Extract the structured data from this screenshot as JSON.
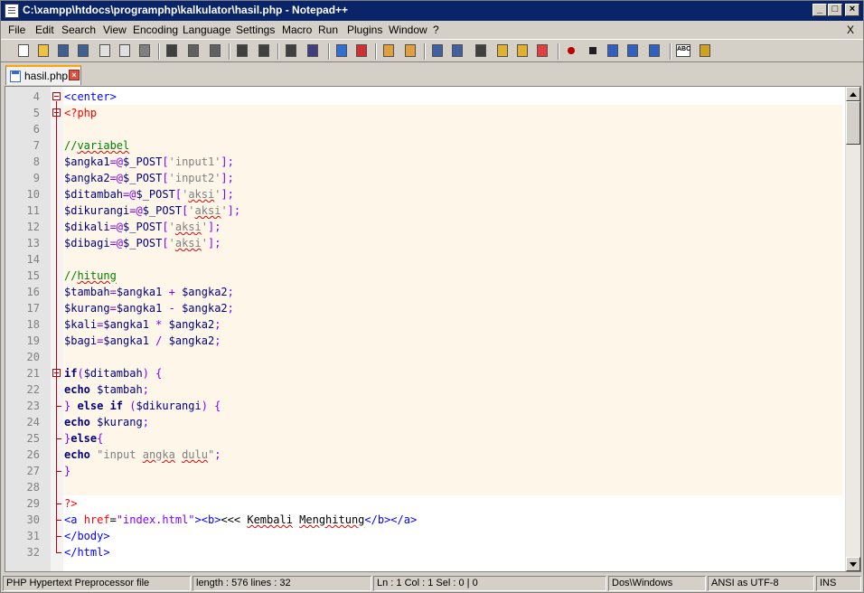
{
  "window": {
    "title": "C:\\xampp\\htdocs\\programphp\\kalkulator\\hasil.php - Notepad++",
    "min_glyph": "_",
    "max_glyph": "□",
    "close_glyph": "×"
  },
  "menubar": {
    "items": [
      "File",
      "Edit",
      "Search",
      "View",
      "Encoding",
      "Language",
      "Settings",
      "Macro",
      "Run",
      "Plugins",
      "Window",
      "?"
    ],
    "close_x": "X"
  },
  "toolbar": {
    "icons": [
      "new-file-icon",
      "open-file-icon",
      "save-icon",
      "save-all-icon",
      "close-icon",
      "close-all-icon",
      "print-icon",
      "cut-icon",
      "copy-icon",
      "paste-icon",
      "undo-icon",
      "redo-icon",
      "find-icon",
      "replace-icon",
      "zoom-in-icon",
      "zoom-out-icon",
      "sync-vertical-icon",
      "sync-horizontal-icon",
      "word-wrap-icon",
      "show-all-chars-icon",
      "indent-guide-icon",
      "udl-icon",
      "doc-map-icon",
      "function-list-icon",
      "record-macro-icon",
      "stop-macro-icon",
      "play-macro-icon",
      "play-multiple-macro-icon",
      "save-macro-icon",
      "spellcheck-icon",
      "spellcheck-settings-icon"
    ]
  },
  "tabs": [
    {
      "label": "hasil.php",
      "active": true
    }
  ],
  "editor": {
    "lines": [
      {
        "n": "4",
        "tokens": [
          {
            "t": "<center>",
            "c": "t-html"
          }
        ]
      },
      {
        "n": "5",
        "tokens": [
          {
            "t": "<?php",
            "c": "t-php"
          }
        ]
      },
      {
        "n": "6",
        "tokens": []
      },
      {
        "n": "7",
        "tokens": [
          {
            "t": "//",
            "c": "t-cmt"
          },
          {
            "t": "variabel",
            "c": "t-cmt spell"
          }
        ]
      },
      {
        "n": "8",
        "tokens": [
          {
            "t": "$angka1",
            "c": "t-var"
          },
          {
            "t": "=@",
            "c": "t-op"
          },
          {
            "t": "$_POST",
            "c": "t-var"
          },
          {
            "t": "[",
            "c": "t-op"
          },
          {
            "t": "'input1'",
            "c": "t-str"
          },
          {
            "t": "];",
            "c": "t-op"
          }
        ]
      },
      {
        "n": "9",
        "tokens": [
          {
            "t": "$angka2",
            "c": "t-var"
          },
          {
            "t": "=@",
            "c": "t-op"
          },
          {
            "t": "$_POST",
            "c": "t-var"
          },
          {
            "t": "[",
            "c": "t-op"
          },
          {
            "t": "'input2'",
            "c": "t-str"
          },
          {
            "t": "];",
            "c": "t-op"
          }
        ]
      },
      {
        "n": "10",
        "tokens": [
          {
            "t": "$ditambah",
            "c": "t-var"
          },
          {
            "t": "=@",
            "c": "t-op"
          },
          {
            "t": "$_POST",
            "c": "t-var"
          },
          {
            "t": "[",
            "c": "t-op"
          },
          {
            "t": "'",
            "c": "t-str"
          },
          {
            "t": "aksi",
            "c": "t-str spell"
          },
          {
            "t": "'",
            "c": "t-str"
          },
          {
            "t": "];",
            "c": "t-op"
          }
        ]
      },
      {
        "n": "11",
        "tokens": [
          {
            "t": "$dikurangi",
            "c": "t-var"
          },
          {
            "t": "=@",
            "c": "t-op"
          },
          {
            "t": "$_POST",
            "c": "t-var"
          },
          {
            "t": "[",
            "c": "t-op"
          },
          {
            "t": "'",
            "c": "t-str"
          },
          {
            "t": "aksi",
            "c": "t-str spell"
          },
          {
            "t": "'",
            "c": "t-str"
          },
          {
            "t": "];",
            "c": "t-op"
          }
        ]
      },
      {
        "n": "12",
        "tokens": [
          {
            "t": "$dikali",
            "c": "t-var"
          },
          {
            "t": "=@",
            "c": "t-op"
          },
          {
            "t": "$_POST",
            "c": "t-var"
          },
          {
            "t": "[",
            "c": "t-op"
          },
          {
            "t": "'",
            "c": "t-str"
          },
          {
            "t": "aksi",
            "c": "t-str spell"
          },
          {
            "t": "'",
            "c": "t-str"
          },
          {
            "t": "];",
            "c": "t-op"
          }
        ]
      },
      {
        "n": "13",
        "tokens": [
          {
            "t": "$dibagi",
            "c": "t-var"
          },
          {
            "t": "=@",
            "c": "t-op"
          },
          {
            "t": "$_POST",
            "c": "t-var"
          },
          {
            "t": "[",
            "c": "t-op"
          },
          {
            "t": "'",
            "c": "t-str"
          },
          {
            "t": "aksi",
            "c": "t-str spell"
          },
          {
            "t": "'",
            "c": "t-str"
          },
          {
            "t": "];",
            "c": "t-op"
          }
        ]
      },
      {
        "n": "14",
        "tokens": []
      },
      {
        "n": "15",
        "tokens": [
          {
            "t": "//",
            "c": "t-cmt"
          },
          {
            "t": "hitung",
            "c": "t-cmt spell"
          }
        ]
      },
      {
        "n": "16",
        "tokens": [
          {
            "t": "$tambah",
            "c": "t-var"
          },
          {
            "t": "=",
            "c": "t-op"
          },
          {
            "t": "$angka1",
            "c": "t-var"
          },
          {
            "t": " + ",
            "c": "t-op"
          },
          {
            "t": "$angka2",
            "c": "t-var"
          },
          {
            "t": ";",
            "c": "t-op"
          }
        ]
      },
      {
        "n": "17",
        "tokens": [
          {
            "t": "$kurang",
            "c": "t-var"
          },
          {
            "t": "=",
            "c": "t-op"
          },
          {
            "t": "$angka1",
            "c": "t-var"
          },
          {
            "t": " - ",
            "c": "t-op"
          },
          {
            "t": "$angka2",
            "c": "t-var"
          },
          {
            "t": ";",
            "c": "t-op"
          }
        ]
      },
      {
        "n": "18",
        "tokens": [
          {
            "t": "$kali",
            "c": "t-var"
          },
          {
            "t": "=",
            "c": "t-op"
          },
          {
            "t": "$angka1",
            "c": "t-var"
          },
          {
            "t": " * ",
            "c": "t-op"
          },
          {
            "t": "$angka2",
            "c": "t-var"
          },
          {
            "t": ";",
            "c": "t-op"
          }
        ]
      },
      {
        "n": "19",
        "tokens": [
          {
            "t": "$bagi",
            "c": "t-var"
          },
          {
            "t": "=",
            "c": "t-op"
          },
          {
            "t": "$angka1",
            "c": "t-var"
          },
          {
            "t": " / ",
            "c": "t-op"
          },
          {
            "t": "$angka2",
            "c": "t-var"
          },
          {
            "t": ";",
            "c": "t-op"
          }
        ]
      },
      {
        "n": "20",
        "tokens": []
      },
      {
        "n": "21",
        "tokens": [
          {
            "t": "if",
            "c": "t-kw"
          },
          {
            "t": "(",
            "c": "t-op"
          },
          {
            "t": "$ditambah",
            "c": "t-var"
          },
          {
            "t": ") {",
            "c": "t-op"
          }
        ]
      },
      {
        "n": "22",
        "tokens": [
          {
            "t": "echo",
            "c": "t-kw"
          },
          {
            "t": " ",
            "c": "t-txt"
          },
          {
            "t": "$tambah",
            "c": "t-var"
          },
          {
            "t": ";",
            "c": "t-op"
          }
        ]
      },
      {
        "n": "23",
        "tokens": [
          {
            "t": "} ",
            "c": "t-op"
          },
          {
            "t": "else if",
            "c": "t-kw"
          },
          {
            "t": " (",
            "c": "t-op"
          },
          {
            "t": "$dikurangi",
            "c": "t-var"
          },
          {
            "t": ") {",
            "c": "t-op"
          }
        ]
      },
      {
        "n": "24",
        "tokens": [
          {
            "t": "echo",
            "c": "t-kw"
          },
          {
            "t": " ",
            "c": "t-txt"
          },
          {
            "t": "$kurang",
            "c": "t-var"
          },
          {
            "t": ";",
            "c": "t-op"
          }
        ]
      },
      {
        "n": "25",
        "tokens": [
          {
            "t": "}",
            "c": "t-op"
          },
          {
            "t": "else",
            "c": "t-kw"
          },
          {
            "t": "{",
            "c": "t-op"
          }
        ]
      },
      {
        "n": "26",
        "tokens": [
          {
            "t": "echo",
            "c": "t-kw"
          },
          {
            "t": " ",
            "c": "t-txt"
          },
          {
            "t": "\"input ",
            "c": "t-str"
          },
          {
            "t": "angka",
            "c": "t-str spell"
          },
          {
            "t": " ",
            "c": "t-str"
          },
          {
            "t": "dulu",
            "c": "t-str spell"
          },
          {
            "t": "\"",
            "c": "t-str"
          },
          {
            "t": ";",
            "c": "t-op"
          }
        ]
      },
      {
        "n": "27",
        "tokens": [
          {
            "t": "}",
            "c": "t-op"
          }
        ]
      },
      {
        "n": "28",
        "tokens": []
      },
      {
        "n": "29",
        "tokens": [
          {
            "t": "?>",
            "c": "t-php"
          }
        ]
      },
      {
        "n": "30",
        "tokens": [
          {
            "t": "<a ",
            "c": "t-html"
          },
          {
            "t": "href",
            "c": "t-attr"
          },
          {
            "t": "=",
            "c": "t-txt"
          },
          {
            "t": "\"index.html\"",
            "c": "t-attrval"
          },
          {
            "t": "><b>",
            "c": "t-html"
          },
          {
            "t": "<<< ",
            "c": "t-txt"
          },
          {
            "t": "Kembali",
            "c": "t-txt spell"
          },
          {
            "t": " ",
            "c": "t-txt"
          },
          {
            "t": "Menghitung",
            "c": "t-txt spell"
          },
          {
            "t": "</b></a>",
            "c": "t-html"
          }
        ]
      },
      {
        "n": "31",
        "tokens": [
          {
            "t": "</body>",
            "c": "t-html"
          }
        ]
      },
      {
        "n": "32",
        "tokens": [
          {
            "t": "</html>",
            "c": "t-html"
          }
        ]
      }
    ]
  },
  "statusbar": {
    "filetype": "PHP Hypertext Preprocessor file",
    "length": "length : 576    lines : 32",
    "position": "Ln : 1    Col : 1    Sel : 0 | 0",
    "eol": "Dos\\Windows",
    "encoding": "ANSI as UTF-8",
    "mode": "INS"
  }
}
